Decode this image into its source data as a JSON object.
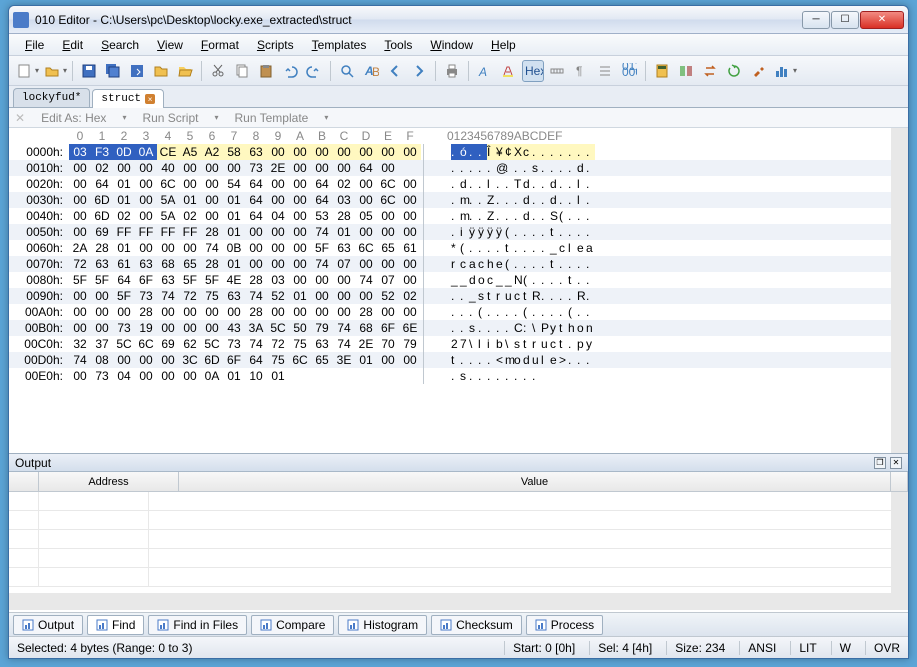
{
  "title": "010 Editor - C:\\Users\\pc\\Desktop\\locky.exe_extracted\\struct",
  "menu": [
    "File",
    "Edit",
    "Search",
    "View",
    "Format",
    "Scripts",
    "Templates",
    "Tools",
    "Window",
    "Help"
  ],
  "tabs": [
    {
      "label": "lockyfud*",
      "active": false,
      "close": false
    },
    {
      "label": "struct",
      "active": true,
      "close": true
    }
  ],
  "edit_info": {
    "edit_as": "Edit As: Hex",
    "run_script": "Run Script",
    "run_template": "Run Template"
  },
  "hex_header": {
    "cols": [
      "0",
      "1",
      "2",
      "3",
      "4",
      "5",
      "6",
      "7",
      "8",
      "9",
      "A",
      "B",
      "C",
      "D",
      "E",
      "F"
    ],
    "ascii": "0123456789ABCDEF"
  },
  "rows": [
    {
      "addr": "0000h:",
      "b": [
        "03",
        "F3",
        "0D",
        "0A",
        "CE",
        "A5",
        "A2",
        "58",
        "63",
        "00",
        "00",
        "00",
        "00",
        "00",
        "00",
        "00"
      ],
      "a": ".ó..Î¥¢Xc......."
    },
    {
      "addr": "0010h:",
      "b": [
        "00",
        "02",
        "00",
        "00",
        "40",
        "00",
        "00",
        "00",
        "73",
        "2E",
        "00",
        "00",
        "00",
        "64",
        "00",
        " "
      ],
      "a": ".....@...s....d."
    },
    {
      "addr": "0020h:",
      "b": [
        "00",
        "64",
        "01",
        "00",
        "6C",
        "00",
        "00",
        "54",
        "64",
        "00",
        "00",
        "64",
        "02",
        "00",
        "6C",
        "00"
      ],
      "a": ".d..l..Td..d..l."
    },
    {
      "addr": "0030h:",
      "b": [
        "00",
        "6D",
        "01",
        "00",
        "5A",
        "01",
        "00",
        "01",
        "64",
        "00",
        "00",
        "64",
        "03",
        "00",
        "6C",
        "00"
      ],
      "a": ".m..Z...d..d..l."
    },
    {
      "addr": "0040h:",
      "b": [
        "00",
        "6D",
        "02",
        "00",
        "5A",
        "02",
        "00",
        "01",
        "64",
        "04",
        "00",
        "53",
        "28",
        "05",
        "00",
        "00"
      ],
      "a": ".m..Z...d..S(..."
    },
    {
      "addr": "0050h:",
      "b": [
        "00",
        "69",
        "FF",
        "FF",
        "FF",
        "FF",
        "28",
        "01",
        "00",
        "00",
        "00",
        "74",
        "01",
        "00",
        "00",
        "00"
      ],
      "a": ".iÿÿÿÿ(....t...."
    },
    {
      "addr": "0060h:",
      "b": [
        "2A",
        "28",
        "01",
        "00",
        "00",
        "00",
        "74",
        "0B",
        "00",
        "00",
        "00",
        "5F",
        "63",
        "6C",
        "65",
        "61"
      ],
      "a": "*(....t...._clea"
    },
    {
      "addr": "0070h:",
      "b": [
        "72",
        "63",
        "61",
        "63",
        "68",
        "65",
        "28",
        "01",
        "00",
        "00",
        "00",
        "74",
        "07",
        "00",
        "00",
        "00"
      ],
      "a": "rcache(....t...."
    },
    {
      "addr": "0080h:",
      "b": [
        "5F",
        "5F",
        "64",
        "6F",
        "63",
        "5F",
        "5F",
        "4E",
        "28",
        "03",
        "00",
        "00",
        "00",
        "74",
        "07",
        "00"
      ],
      "a": "__doc__N(....t.."
    },
    {
      "addr": "0090h:",
      "b": [
        "00",
        "00",
        "5F",
        "73",
        "74",
        "72",
        "75",
        "63",
        "74",
        "52",
        "01",
        "00",
        "00",
        "00",
        "52",
        "02"
      ],
      "a": ".._structR....R."
    },
    {
      "addr": "00A0h:",
      "b": [
        "00",
        "00",
        "00",
        "28",
        "00",
        "00",
        "00",
        "00",
        "28",
        "00",
        "00",
        "00",
        "00",
        "28",
        "00",
        "00"
      ],
      "a": "...(....(....(.."
    },
    {
      "addr": "00B0h:",
      "b": [
        "00",
        "00",
        "73",
        "19",
        "00",
        "00",
        "00",
        "43",
        "3A",
        "5C",
        "50",
        "79",
        "74",
        "68",
        "6F",
        "6E"
      ],
      "a": "..s....C:\\Python"
    },
    {
      "addr": "00C0h:",
      "b": [
        "32",
        "37",
        "5C",
        "6C",
        "69",
        "62",
        "5C",
        "73",
        "74",
        "72",
        "75",
        "63",
        "74",
        "2E",
        "70",
        "79"
      ],
      "a": "27\\lib\\struct.py"
    },
    {
      "addr": "00D0h:",
      "b": [
        "74",
        "08",
        "00",
        "00",
        "00",
        "3C",
        "6D",
        "6F",
        "64",
        "75",
        "6C",
        "65",
        "3E",
        "01",
        "00",
        "00"
      ],
      "a": "t....<module>..."
    },
    {
      "addr": "00E0h:",
      "b": [
        "00",
        "73",
        "04",
        "00",
        "00",
        "00",
        "0A",
        "01",
        "10",
        "01",
        " ",
        " ",
        " ",
        " ",
        " ",
        " "
      ],
      "a": ".s........"
    }
  ],
  "output": {
    "title": "Output",
    "headers": {
      "address": "Address",
      "value": "Value"
    }
  },
  "bottom_tabs": [
    {
      "label": "Output",
      "icon": "#4a7bc8"
    },
    {
      "label": "Find",
      "icon": "#4a7bc8",
      "active": true
    },
    {
      "label": "Find in Files",
      "icon": "#4a7bc8"
    },
    {
      "label": "Compare",
      "icon": "#4a7bc8"
    },
    {
      "label": "Histogram",
      "icon": "#4a7bc8"
    },
    {
      "label": "Checksum",
      "icon": "#4a7bc8"
    },
    {
      "label": "Process",
      "icon": "#4a7bc8"
    }
  ],
  "status": {
    "selection": "Selected: 4 bytes (Range: 0 to 3)",
    "start": "Start: 0 [0h]",
    "sel": "Sel: 4 [4h]",
    "size": "Size: 234",
    "enc": "ANSI",
    "lit": "LIT",
    "w": "W",
    "ovr": "OVR"
  },
  "selection": {
    "row": 0,
    "start": 0,
    "end": 3
  },
  "highlight": {
    "row": 0,
    "start": 4,
    "end": 15
  }
}
